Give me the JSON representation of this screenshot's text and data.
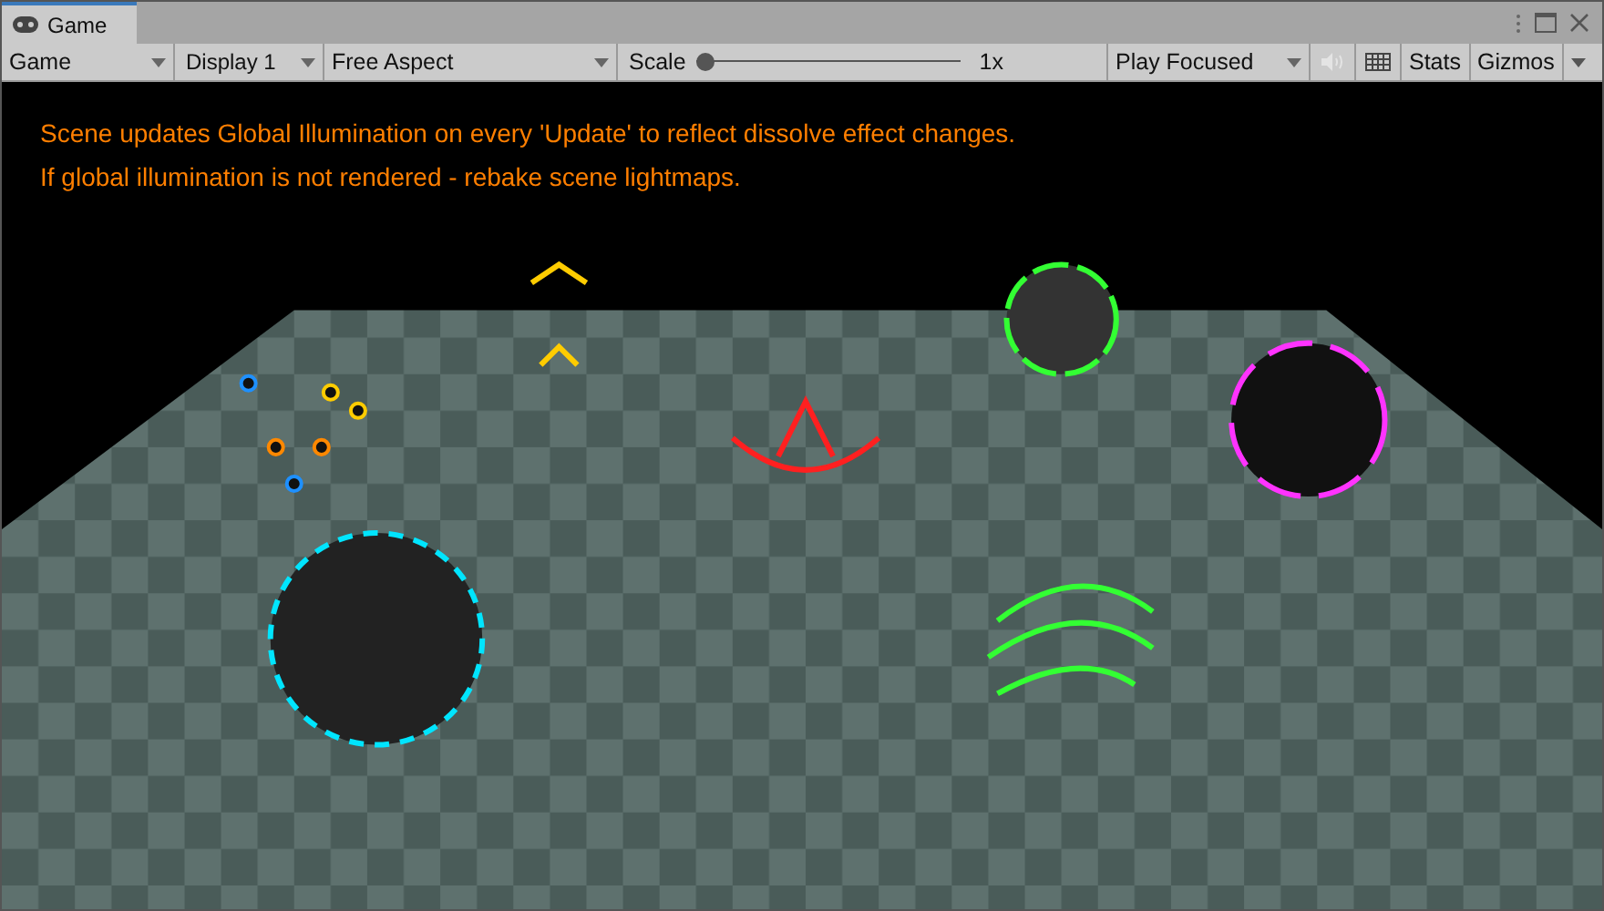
{
  "tab": {
    "title": "Game",
    "selected": true
  },
  "toolbar": {
    "view_dropdown": "Game",
    "display_dropdown": "Display 1",
    "aspect_dropdown": "Free Aspect",
    "scale": {
      "label": "Scale",
      "level": 0,
      "reading": "1x"
    },
    "play_mode_dropdown": "Play Focused",
    "stats_button": "Stats",
    "gizmos_button": "Gizmos"
  },
  "messages": [
    "Scene updates Global Illumination on every 'Update' to reflect dissolve effect changes.",
    "If global illumination is not rendered - rebake scene lightmaps."
  ]
}
